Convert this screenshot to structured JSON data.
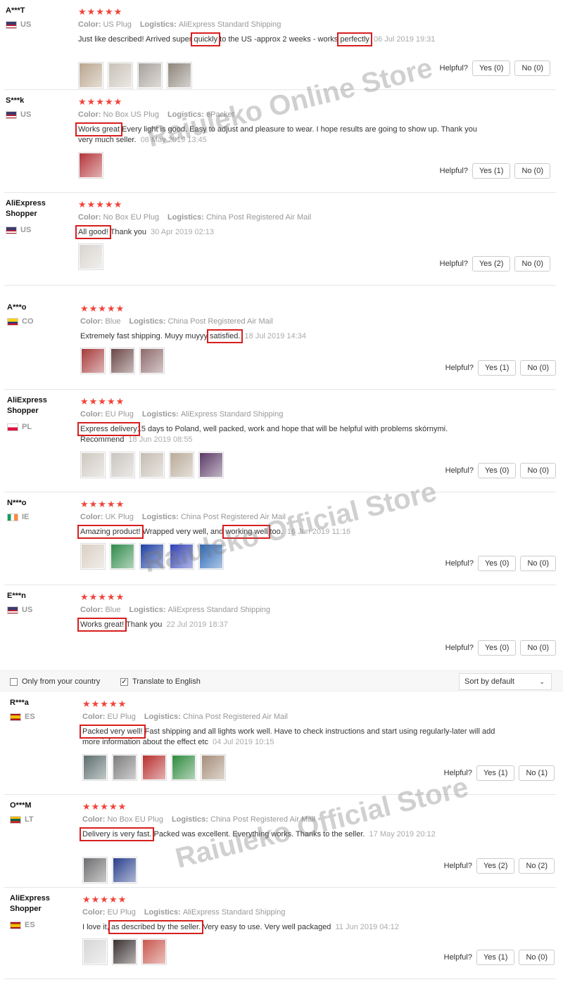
{
  "colors": {
    "star": "#f0443a",
    "highlight": "#d81e1e",
    "watermark": "#888888"
  },
  "helpful_label": "Helpful?",
  "filter": {
    "only_country": "Only from your country",
    "translate": "Translate to English",
    "sort": "Sort by default"
  },
  "watermarks": [
    "Raiuleko Online Store",
    "Raiuleko Official Store",
    "Raiuleko Official Store"
  ],
  "reviews": [
    {
      "user": "A***T",
      "country": "US",
      "stars": "★★★★★",
      "color_label": "Color:",
      "color": "US Plug",
      "logistics_label": "Logistics:",
      "logistics": "AliExpress Standard Shipping",
      "segments": [
        [
          "Just like described! Arrived super ",
          false
        ],
        [
          "quickly",
          true
        ],
        [
          " to the US -approx 2 weeks - works ",
          false
        ],
        [
          "perfectly",
          true
        ]
      ],
      "date": "06 Jul 2019 19:31",
      "yes": "Yes (0)",
      "no": "No (0)",
      "photos": [
        "#b9a58e",
        "#c8c2b7",
        "#a7a19a",
        "#8d857b"
      ]
    },
    {
      "user": "S***k",
      "country": "US",
      "stars": "★★★★★",
      "color_label": "Color:",
      "color": "No Box US Plug",
      "logistics_label": "Logistics:",
      "logistics": "ePacket",
      "segments": [
        [
          "Works great",
          true
        ],
        [
          " Every light is good. Easy to adjust and pleasure to wear. I hope results are going to show up. Thank you very much seller.",
          false
        ]
      ],
      "date": "08 May 2019 13:45",
      "yes": "Yes (1)",
      "no": "No (0)",
      "photos": [
        "#b3353a"
      ]
    },
    {
      "user": "AliExpress Shopper",
      "country": "US",
      "stars": "★★★★★",
      "color_label": "Color:",
      "color": "No Box EU Plug",
      "logistics_label": "Logistics:",
      "logistics": "China Post Registered Air Mail",
      "segments": [
        [
          "All good!",
          true
        ],
        [
          " Thank you",
          false
        ]
      ],
      "date": "30 Apr 2019 02:13",
      "yes": "Yes (2)",
      "no": "No (0)",
      "photos": [
        "#d8d4cf"
      ]
    },
    {
      "user": "A***o",
      "country": "CO",
      "stars": "★★★★★",
      "color_label": "Color:",
      "color": "Blue",
      "logistics_label": "Logistics:",
      "logistics": "China Post Registered Air Mail",
      "segments": [
        [
          "Extremely fast shipping. Muyy muyyy ",
          false
        ],
        [
          "satisfied.",
          true
        ]
      ],
      "date": "18 Jul 2019 14:34",
      "yes": "Yes (1)",
      "no": "No (0)",
      "photos": [
        "#a63a3a",
        "#6b4747",
        "#8e6a6a"
      ]
    },
    {
      "user": "AliExpress Shopper",
      "country": "PL",
      "stars": "★★★★★",
      "color_label": "Color:",
      "color": "EU Plug",
      "logistics_label": "Logistics:",
      "logistics": "AliExpress Standard Shipping",
      "segments": [
        [
          "Express delivery",
          true
        ],
        [
          "15 days to Poland, well packed, work and hope that will be helpful with problems skórnymi. Recommend",
          false
        ]
      ],
      "date": "18 Jun 2019 08:55",
      "yes": "Yes (0)",
      "no": "No (0)",
      "photos": [
        "#cfc8c0",
        "#c9c5c0",
        "#c4bcb2",
        "#b8ab99",
        "#5a3a66"
      ]
    },
    {
      "user": "N***o",
      "country": "IE",
      "stars": "★★★★★",
      "color_label": "Color:",
      "color": "UK Plug",
      "logistics_label": "Logistics:",
      "logistics": "China Post Registered Air Mail",
      "segments": [
        [
          "Amazing product!",
          true
        ],
        [
          " Wrapped very well, and ",
          false
        ],
        [
          "working well",
          true
        ],
        [
          " too.",
          false
        ]
      ],
      "date": "16 Jun 2019 11:16",
      "yes": "Yes (0)",
      "no": "No (0)",
      "photos": [
        "#d9cfc4",
        "#2f8a4a",
        "#1e3fa2",
        "#2e3fb8",
        "#2867b8"
      ]
    },
    {
      "user": "E***n",
      "country": "US",
      "stars": "★★★★★",
      "color_label": "Color:",
      "color": "Blue",
      "logistics_label": "Logistics:",
      "logistics": "AliExpress Standard Shipping",
      "segments": [
        [
          "Works great!",
          true
        ],
        [
          " Thank you",
          false
        ]
      ],
      "date": "22 Jul 2019 18:37",
      "yes": "Yes (0)",
      "no": "No (0)",
      "photos": []
    },
    {
      "user": "R***a",
      "country": "ES",
      "stars": "★★★★★",
      "color_label": "Color:",
      "color": "EU Plug",
      "logistics_label": "Logistics:",
      "logistics": "China Post Registered Air Mail",
      "segments": [
        [
          "Packed very well!",
          true
        ],
        [
          " Fast shipping and all lights work well. Have to check instructions and start using regularly-later will add more information about the effect etc",
          false
        ]
      ],
      "date": "04 Jul 2019 10:15",
      "yes": "Yes (1)",
      "no": "No (1)",
      "photos": [
        "#5d6e6e",
        "#7d7d7d",
        "#b82f2f",
        "#2f8a3e",
        "#a58e7a"
      ]
    },
    {
      "user": "O***M",
      "country": "LT",
      "stars": "★★★★★",
      "color_label": "Color:",
      "color": "No Box EU Plug",
      "logistics_label": "Logistics:",
      "logistics": "China Post Registered Air Mail",
      "segments": [
        [
          "Delivery is very fast.",
          true
        ],
        [
          " Packed was excellent. Everything works. Thanks to the seller.",
          false
        ]
      ],
      "date": "17 May 2019 20:12",
      "yes": "Yes (2)",
      "no": "No (2)",
      "photos": [
        "#6e6e70",
        "#2a3f8c"
      ]
    },
    {
      "user": "AliExpress Shopper",
      "country": "ES",
      "stars": "★★★★★",
      "color_label": "Color:",
      "color": "EU Plug",
      "logistics_label": "Logistics:",
      "logistics": "AliExpress Standard Shipping",
      "segments": [
        [
          "I love it, ",
          false
        ],
        [
          "as described by the seller.",
          true
        ],
        [
          " Very easy to use. Very well packaged",
          false
        ]
      ],
      "date": "11 Jun 2019 04:12",
      "yes": "Yes (1)",
      "no": "No (0)",
      "photos": [
        "#d6d6d6",
        "#3a3030",
        "#c8574e"
      ]
    }
  ]
}
